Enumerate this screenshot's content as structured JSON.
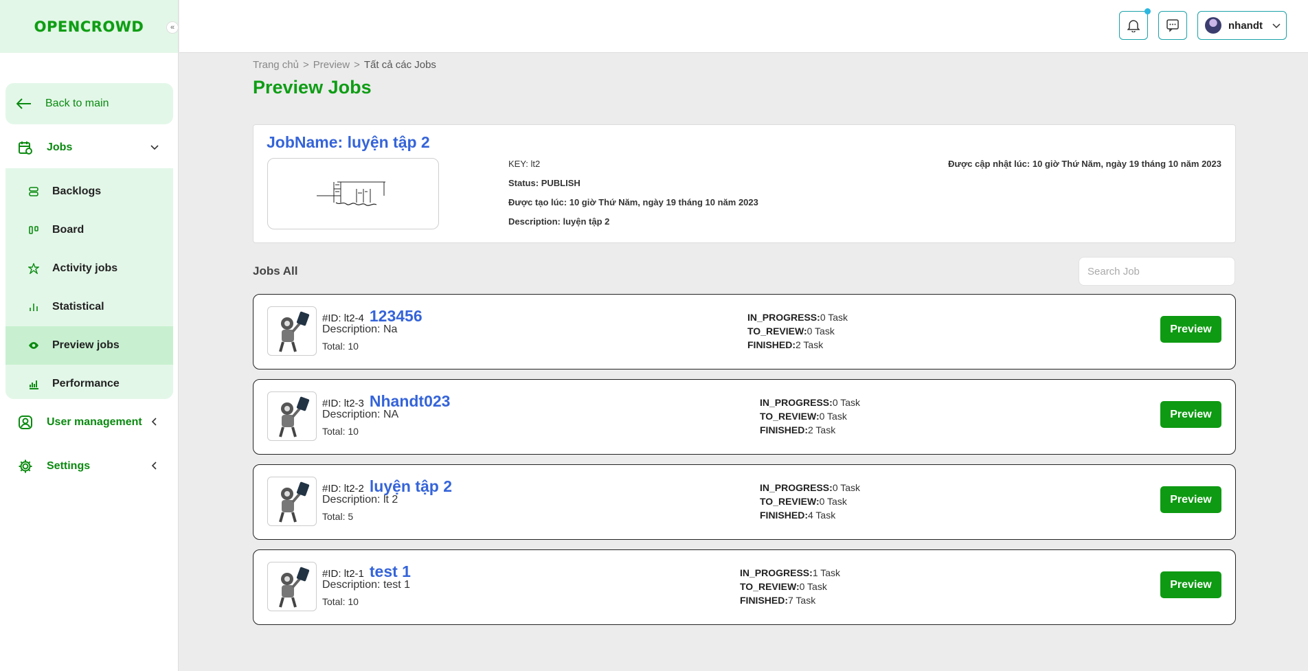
{
  "brand": {
    "logo_text": "OPENCROWD",
    "collapse_glyph": "«"
  },
  "sidebar": {
    "back_label": "Back to main",
    "jobs_label": "Jobs",
    "sub_items": [
      {
        "label": "Backlogs",
        "icon": "layers-icon"
      },
      {
        "label": "Board",
        "icon": "board-icon"
      },
      {
        "label": "Activity jobs",
        "icon": "activity-icon"
      },
      {
        "label": "Statistical",
        "icon": "stats-icon"
      },
      {
        "label": "Preview jobs",
        "icon": "eye-icon",
        "active": true
      },
      {
        "label": "Performance",
        "icon": "performance-icon"
      }
    ],
    "user_management_label": "User management",
    "settings_label": "Settings"
  },
  "topbar": {
    "username": "nhandt"
  },
  "breadcrumb": {
    "home": "Trang chủ",
    "sep": ">",
    "preview": "Preview",
    "current": "Tất cả các Jobs"
  },
  "page_title": "Preview Jobs",
  "job_detail": {
    "name": "JobName: luyện tập 2",
    "key_label": "KEY:",
    "key": "lt2",
    "status_label": "Status:",
    "status": "PUBLISH",
    "created_label": "Được tạo lúc:",
    "created": "10 giờ Thứ Năm, ngày 19 tháng 10 năm 2023",
    "description_label": "Description:",
    "description": "luyện tập 2",
    "updated": "Được cập nhật lúc: 10 giờ Thứ Năm, ngày 19 tháng 10 năm 2023"
  },
  "jobs_all_label": "Jobs All",
  "search": {
    "placeholder": "Search Job"
  },
  "labels": {
    "id_prefix": "#ID:",
    "desc_prefix": "Description:",
    "total_prefix": "Total:",
    "in_progress": "IN_PROGRESS:",
    "to_review": "TO_REVIEW:",
    "finished": "FINISHED:",
    "preview_btn": "Preview"
  },
  "jobs": [
    {
      "id": "lt2-4",
      "title": "123456",
      "description": "Na",
      "total": "10",
      "in_progress": "0 Task",
      "to_review": "0 Task",
      "finished": "2 Task"
    },
    {
      "id": "lt2-3",
      "title": "Nhandt023",
      "description": "NA",
      "total": "10",
      "in_progress": "0 Task",
      "to_review": "0 Task",
      "finished": "2 Task"
    },
    {
      "id": "lt2-2",
      "title": "luyện tập 2",
      "description": "lt 2",
      "total": "5",
      "in_progress": "0 Task",
      "to_review": "0 Task",
      "finished": "4 Task"
    },
    {
      "id": "lt2-1",
      "title": "test 1",
      "description": "test 1",
      "total": "10",
      "in_progress": "1 Task",
      "to_review": "0 Task",
      "finished": "7 Task"
    }
  ],
  "colors": {
    "brand_green": "#0e9d14",
    "title_blue": "#3564d9",
    "accent_teal": "#19a1a8",
    "sidebar_bg": "#e3f7e8"
  }
}
